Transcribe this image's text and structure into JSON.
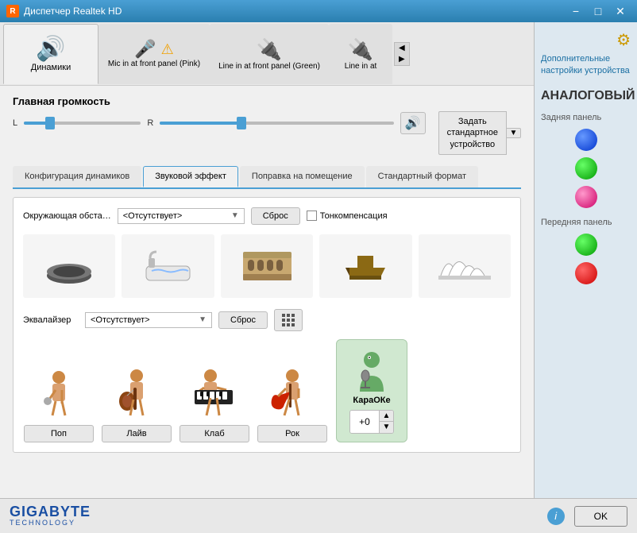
{
  "titlebar": {
    "title": "Диспетчер Realtek HD",
    "minimize": "−",
    "maximize": "□",
    "close": "✕"
  },
  "device_tabs": [
    {
      "id": "speakers",
      "label": "Динамики",
      "icon": "🔊",
      "active": true
    },
    {
      "id": "mic_front",
      "label": "Mic in at front panel (Pink)",
      "icon": "🎤"
    },
    {
      "id": "line_front",
      "label": "Line in at front panel (Green)",
      "icon": "🔌"
    },
    {
      "id": "line_rear",
      "label": "Line in at",
      "icon": "🔌"
    }
  ],
  "volume": {
    "label": "Главная громкость",
    "l_label": "L",
    "r_label": "R",
    "value_percent": 35,
    "speaker_icon": "🔊",
    "set_default_label": "Задать\nстандартное\nустройство",
    "arrow": "▼"
  },
  "tabs": [
    {
      "id": "config",
      "label": "Конфигурация динамиков",
      "active": false
    },
    {
      "id": "sound_effect",
      "label": "Звуковой эффект",
      "active": true
    },
    {
      "id": "room",
      "label": "Поправка на помещение",
      "active": false
    },
    {
      "id": "format",
      "label": "Стандартный формат",
      "active": false
    }
  ],
  "sound_effect": {
    "environment": {
      "label": "Окружающая обста…",
      "select_value": "<Отсутствует>",
      "reset_label": "Сброс",
      "tonecomp_label": "Тонкомпенсация",
      "icons": [
        "🎵",
        "🛁",
        "🏛️",
        "📦",
        "🏙️"
      ]
    },
    "equalizer": {
      "label": "Эквалайзер",
      "select_value": "<Отсутствует>",
      "reset_label": "Сброс",
      "grid_icon": "⊞",
      "presets": [
        {
          "id": "pop",
          "icon": "🎤",
          "label": "Поп"
        },
        {
          "id": "live",
          "icon": "🎸",
          "label": "Лайв"
        },
        {
          "id": "club",
          "icon": "🎹",
          "label": "Клаб"
        },
        {
          "id": "rock",
          "icon": "🎸",
          "label": "Рок"
        }
      ]
    },
    "karaoke": {
      "icon": "🎤",
      "label": "КараОКе",
      "value": "+0"
    }
  },
  "right_panel": {
    "link_text": "Дополнительные настройки устройства",
    "title": "АНАЛОГОВЫЙ",
    "rear_panel_label": "Задняя панель",
    "front_panel_label": "Передняя панель",
    "jacks": {
      "rear": [
        "blue",
        "green",
        "pink"
      ],
      "front": [
        "green",
        "red"
      ]
    }
  },
  "bottom": {
    "brand": "GIGABYTE",
    "tech": "TECHNOLOGY",
    "info_label": "i",
    "ok_label": "OK"
  }
}
